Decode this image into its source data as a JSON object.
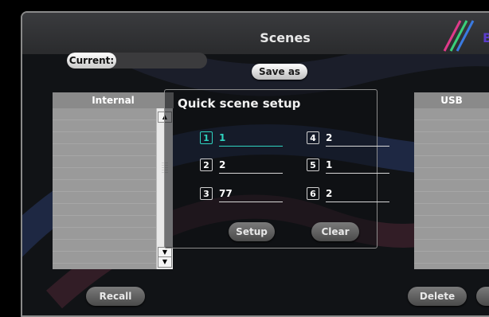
{
  "window": {
    "title": "Scenes",
    "logo_text": "B"
  },
  "current": {
    "label": "Current:",
    "value": ""
  },
  "buttons": {
    "save_as": "Save as",
    "recall": "Recall",
    "delete": "Delete",
    "setup": "Setup",
    "clear": "Clear"
  },
  "internal": {
    "header": "Internal"
  },
  "usb": {
    "header": "USB"
  },
  "quick_setup": {
    "title": "Quick scene setup",
    "slots": [
      {
        "num": "1",
        "value": "1"
      },
      {
        "num": "2",
        "value": "2"
      },
      {
        "num": "3",
        "value": "77"
      },
      {
        "num": "4",
        "value": "2"
      },
      {
        "num": "5",
        "value": "1"
      },
      {
        "num": "6",
        "value": "2"
      }
    ]
  },
  "colors": {
    "accent": "#2fd3c0",
    "brand": "#5b3dc9"
  },
  "icons": {
    "scroll_up": "scroll-up-icon",
    "scroll_down": "scroll-down-icon",
    "logo": "logo-stripes-icon"
  }
}
